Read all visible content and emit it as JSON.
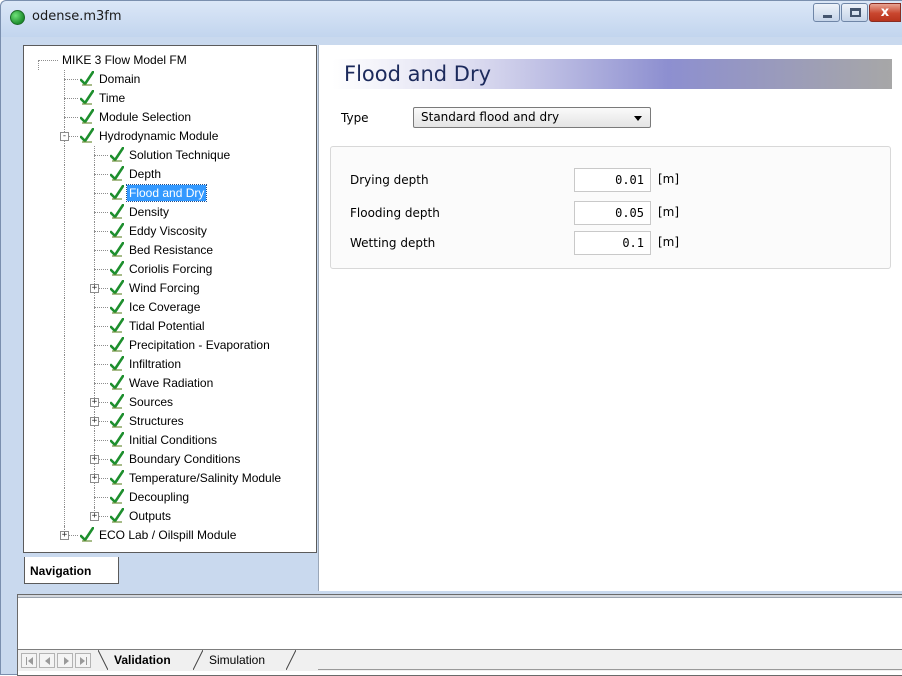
{
  "window": {
    "title": "odense.m3fm",
    "close_glyph": "x"
  },
  "tree": {
    "items": [
      {
        "label": "MIKE 3 Flow Model FM",
        "level": 0,
        "check": false,
        "expander": ""
      },
      {
        "label": "Domain",
        "level": 1,
        "check": true,
        "expander": ""
      },
      {
        "label": "Time",
        "level": 1,
        "check": true,
        "expander": ""
      },
      {
        "label": "Module Selection",
        "level": 1,
        "check": true,
        "expander": ""
      },
      {
        "label": "Hydrodynamic Module",
        "level": 1,
        "check": true,
        "expander": "-"
      },
      {
        "label": "Solution Technique",
        "level": 2,
        "check": true,
        "expander": ""
      },
      {
        "label": "Depth",
        "level": 2,
        "check": true,
        "expander": ""
      },
      {
        "label": "Flood and Dry",
        "level": 2,
        "check": true,
        "expander": "",
        "selected": true
      },
      {
        "label": "Density",
        "level": 2,
        "check": true,
        "expander": ""
      },
      {
        "label": "Eddy Viscosity",
        "level": 2,
        "check": true,
        "expander": ""
      },
      {
        "label": "Bed Resistance",
        "level": 2,
        "check": true,
        "expander": ""
      },
      {
        "label": "Coriolis Forcing",
        "level": 2,
        "check": true,
        "expander": ""
      },
      {
        "label": "Wind Forcing",
        "level": 2,
        "check": true,
        "expander": "+"
      },
      {
        "label": "Ice Coverage",
        "level": 2,
        "check": true,
        "expander": ""
      },
      {
        "label": "Tidal Potential",
        "level": 2,
        "check": true,
        "expander": ""
      },
      {
        "label": "Precipitation - Evaporation",
        "level": 2,
        "check": true,
        "expander": ""
      },
      {
        "label": "Infiltration",
        "level": 2,
        "check": true,
        "expander": ""
      },
      {
        "label": "Wave Radiation",
        "level": 2,
        "check": true,
        "expander": ""
      },
      {
        "label": "Sources",
        "level": 2,
        "check": true,
        "expander": "+"
      },
      {
        "label": "Structures",
        "level": 2,
        "check": true,
        "expander": "+"
      },
      {
        "label": "Initial Conditions",
        "level": 2,
        "check": true,
        "expander": ""
      },
      {
        "label": "Boundary Conditions",
        "level": 2,
        "check": true,
        "expander": "+"
      },
      {
        "label": "Temperature/Salinity Module",
        "level": 2,
        "check": true,
        "expander": "+"
      },
      {
        "label": "Decoupling",
        "level": 2,
        "check": true,
        "expander": ""
      },
      {
        "label": "Outputs",
        "level": 2,
        "check": true,
        "expander": "+"
      },
      {
        "label": "ECO Lab / Oilspill Module",
        "level": 1,
        "check": true,
        "expander": "+"
      }
    ],
    "check_icon": "green-check-icon",
    "check_color": "#1e8f2e"
  },
  "navigation_tab": {
    "label": "Navigation"
  },
  "page": {
    "heading": "Flood and Dry",
    "type_label": "Type",
    "type_value": "Standard flood and dry",
    "params": [
      {
        "label": "Drying depth",
        "value": "0.01",
        "unit": "[m]"
      },
      {
        "label": "Flooding depth",
        "value": "0.05",
        "unit": "[m]"
      },
      {
        "label": "Wetting depth",
        "value": "0.1",
        "unit": "[m]"
      }
    ]
  },
  "bottom": {
    "tabs": [
      {
        "label": "Validation",
        "active": true
      },
      {
        "label": "Simulation",
        "active": false
      }
    ]
  }
}
